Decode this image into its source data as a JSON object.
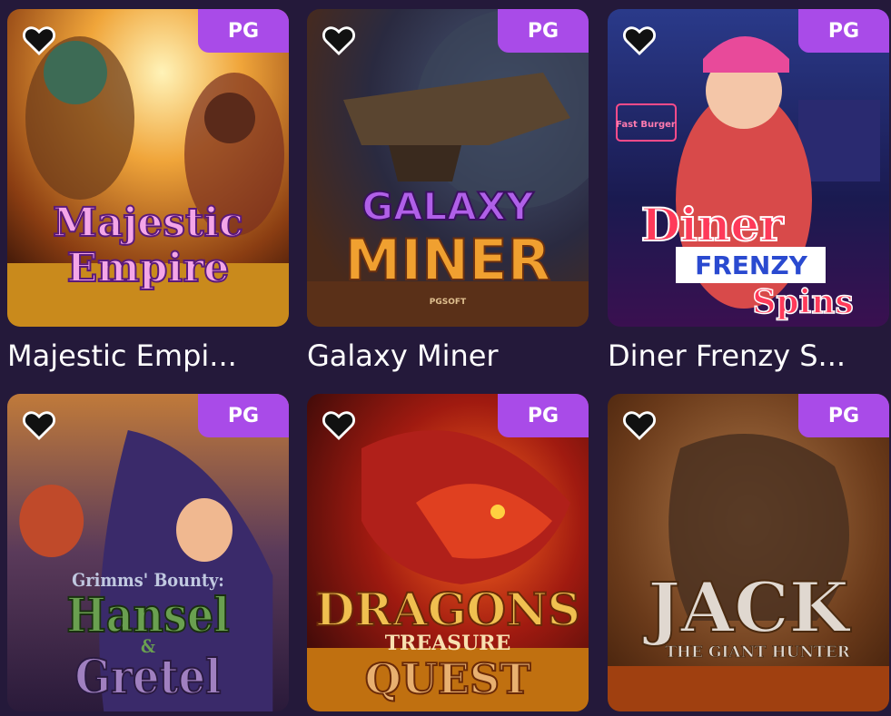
{
  "games": [
    {
      "title": "Majestic Empi...",
      "provider": "PG",
      "cover_text": [
        "Majestic",
        "Empire"
      ],
      "favorite_icon": "heart-outline-icon"
    },
    {
      "title": "Galaxy Miner",
      "provider": "PG",
      "cover_text": [
        "GALAXY",
        "MINER",
        "PGSOFT"
      ],
      "favorite_icon": "heart-outline-icon"
    },
    {
      "title": "Diner Frenzy S...",
      "provider": "PG",
      "cover_text": [
        "Diner",
        "FRENZY",
        "Spins",
        "Fast Burger"
      ],
      "favorite_icon": "heart-outline-icon"
    },
    {
      "title": "",
      "provider": "PG",
      "cover_text": [
        "Grimms' Bounty:",
        "Hansel",
        "&",
        "Gretel"
      ],
      "favorite_icon": "heart-outline-icon"
    },
    {
      "title": "",
      "provider": "PG",
      "cover_text": [
        "DRAGONS",
        "TREASURE",
        "QUEST"
      ],
      "favorite_icon": "heart-outline-icon"
    },
    {
      "title": "",
      "provider": "PG",
      "cover_text": [
        "JACK",
        "THE GIANT HUNTER"
      ],
      "favorite_icon": "heart-outline-icon"
    }
  ],
  "colors": {
    "background": "#24193a",
    "badge": "#a94be8",
    "title": "#ffffff"
  }
}
